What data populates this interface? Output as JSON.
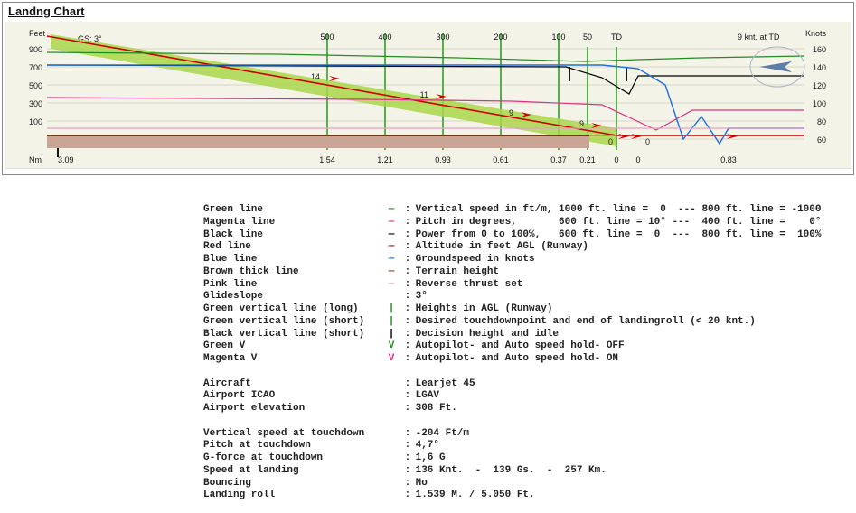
{
  "title": "Landng Chart",
  "chart_data": {
    "type": "line",
    "x_axis": {
      "label": "Nm",
      "values": [
        3.09,
        1.54,
        1.21,
        0.93,
        0.61,
        0.37,
        0.21,
        0,
        0,
        0.83
      ]
    },
    "y_left": {
      "label": "Feet",
      "ticks": [
        100,
        300,
        500,
        700,
        900
      ]
    },
    "y_right": {
      "label": "Knots",
      "ticks": [
        60,
        80,
        100,
        120,
        140,
        160
      ]
    },
    "top_distance_markers": [
      500,
      400,
      300,
      200,
      100,
      50,
      "TD"
    ],
    "gs_label": "GS: 3°",
    "td_label": "9 knt. at TD",
    "callouts": [
      {
        "x": 500,
        "value": 14
      },
      {
        "x": 400,
        "value": 11
      },
      {
        "x": 300,
        "value": 9
      },
      {
        "x": 50,
        "value": 9
      },
      {
        "x": 0,
        "value": 0
      },
      {
        "x": 0,
        "value": 0
      }
    ],
    "series": [
      {
        "name": "Vertical speed (green)",
        "color": "#228b22"
      },
      {
        "name": "Pitch (magenta)",
        "color": "#d63384"
      },
      {
        "name": "Power (black)",
        "color": "#000000"
      },
      {
        "name": "Altitude AGL (red)",
        "color": "#cc0000"
      },
      {
        "name": "Groundspeed (blue)",
        "color": "#1e70d6"
      },
      {
        "name": "Terrain (brown thick)",
        "color": "#8b4513"
      },
      {
        "name": "Reverse thrust (pink)",
        "color": "#e6a0c4"
      }
    ],
    "glideslope_deg": 3
  },
  "legend": [
    {
      "label": "Green line",
      "sym": "—",
      "color": "#228b22",
      "desc": "Vertical speed in ft/m, 1000 ft. line =  0  --- 800 ft. line = -1000"
    },
    {
      "label": "Magenta line",
      "sym": "—",
      "color": "#d63384",
      "desc": "Pitch in degrees,       600 ft. line = 10° ---  400 ft. line =    0°"
    },
    {
      "label": "Black line",
      "sym": "—",
      "color": "#000000",
      "desc": "Power from 0 to 100%,   600 ft. line =  0  ---  800 ft. line =  100%"
    },
    {
      "label": "Red line",
      "sym": "—",
      "color": "#cc0000",
      "desc": "Altitude in feet AGL (Runway)"
    },
    {
      "label": "Blue line",
      "sym": "—",
      "color": "#1e70d6",
      "desc": "Groundspeed in knots"
    },
    {
      "label": "Brown thick line",
      "sym": "—",
      "color": "#8b4513",
      "desc": "Terrain height"
    },
    {
      "label": "Pink line",
      "sym": "—",
      "color": "#e6a0c4",
      "desc": "Reverse thrust set"
    },
    {
      "label": "Glideslope",
      "sym": "",
      "color": "",
      "desc": "3°"
    },
    {
      "label": "Green vertical line (long)",
      "sym": "|",
      "color": "#228b22",
      "desc": "Heights in AGL (Runway)"
    },
    {
      "label": "Green vertical line (short)",
      "sym": "|",
      "color": "#228b22",
      "desc": "Desired touchdownpoint and end of landingroll (< 20 knt.)"
    },
    {
      "label": "Black vertical line (short)",
      "sym": "|",
      "color": "#000000",
      "desc": "Decision height and idle"
    },
    {
      "label": "Green V",
      "sym": "V",
      "color": "#228b22",
      "desc": "Autopilot- and Auto speed hold- OFF"
    },
    {
      "label": "Magenta V",
      "sym": "V",
      "color": "#d63384",
      "desc": "Autopilot- and Auto speed hold- ON"
    }
  ],
  "info_ac": [
    {
      "label": "Aircraft",
      "value": "Learjet 45"
    },
    {
      "label": "Airport ICAO",
      "value": "LGAV"
    },
    {
      "label": "Airport elevation",
      "value": "308 Ft."
    }
  ],
  "info_perf": [
    {
      "label": "Vertical speed at touchdown",
      "value": "-204 Ft/m"
    },
    {
      "label": "Pitch at touchdown",
      "value": "4,7°"
    },
    {
      "label": "G-force at touchdown",
      "value": "1,6 G"
    },
    {
      "label": "Speed at landing",
      "value": "136 Knt.  -  139 Gs.  -  257 Km."
    },
    {
      "label": "Bouncing",
      "value": "No"
    },
    {
      "label": "Landing roll",
      "value": "1.539 M. / 5.050 Ft."
    }
  ]
}
